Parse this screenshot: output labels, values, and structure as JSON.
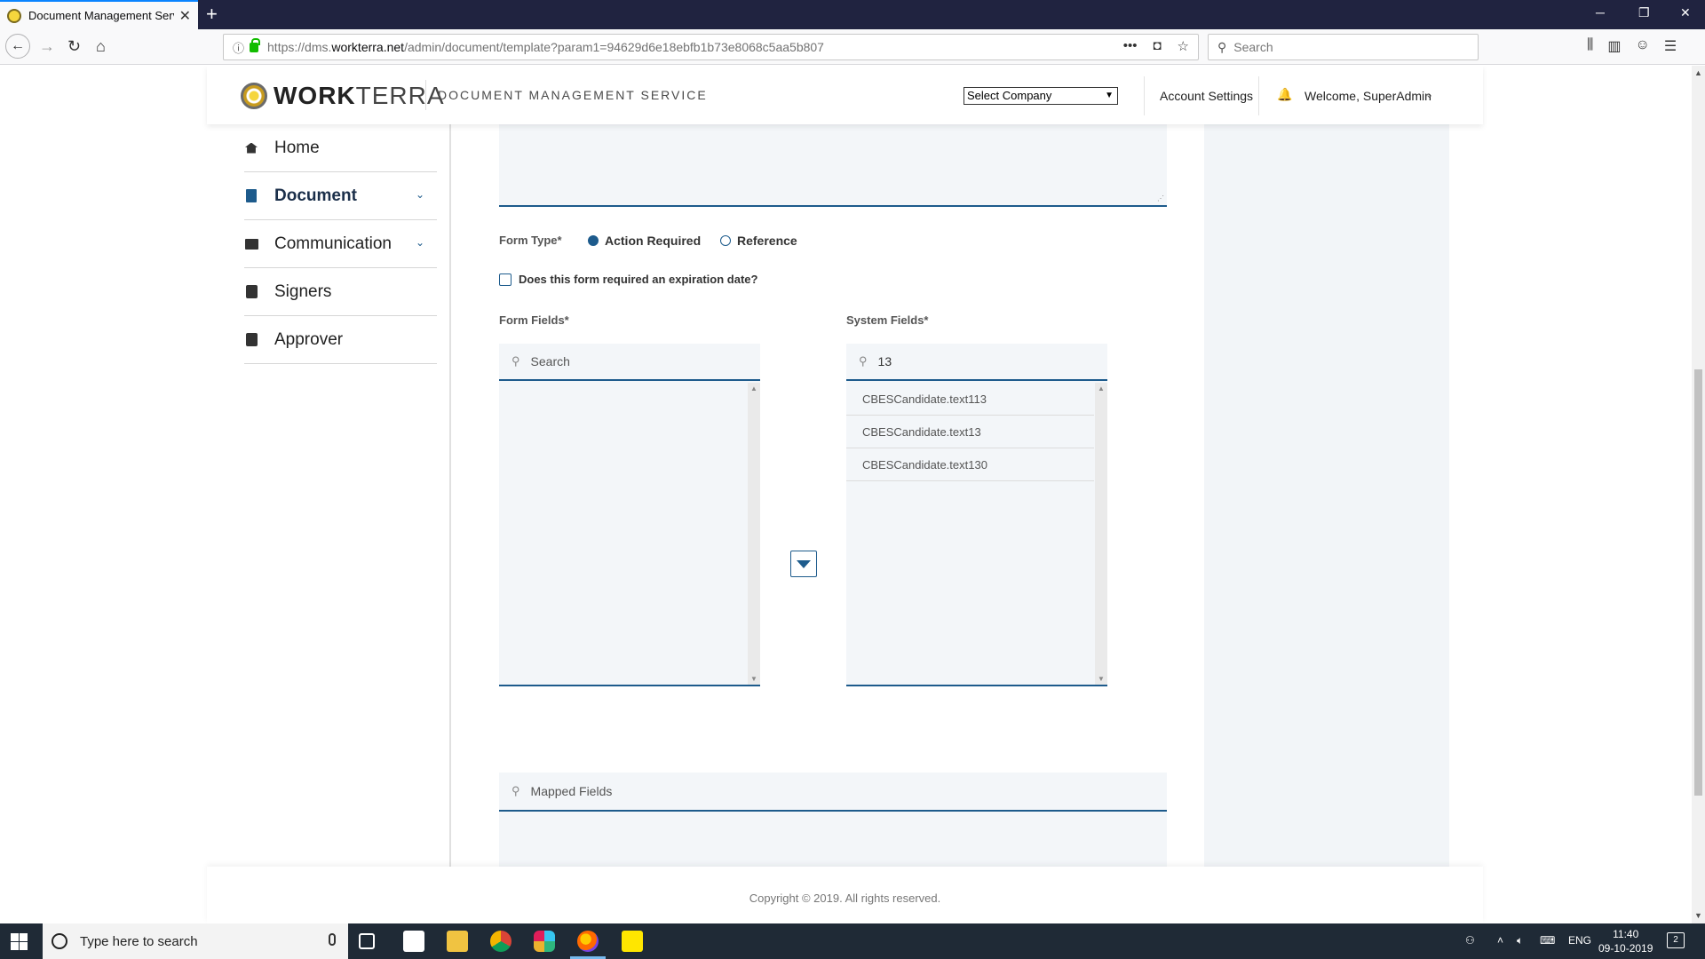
{
  "browser": {
    "tab_title": "Document Management Servic",
    "new_tab_label": "+",
    "url_prefix": "https://dms.",
    "url_domain": "workterra.net",
    "url_path": "/admin/document/template?param1=94629d6e18ebfb1b73e8068c5aa5b807",
    "search_placeholder": "Search"
  },
  "header": {
    "logo_bold": "WORK",
    "logo_thin": "TERRA",
    "service_name": "DOCUMENT MANAGEMENT SERVICE",
    "company_select": "Select Company",
    "account_settings": "Account Settings",
    "welcome": "Welcome, SuperAdmin"
  },
  "sidebar": {
    "items": [
      {
        "label": "Home"
      },
      {
        "label": "Document"
      },
      {
        "label": "Communication"
      },
      {
        "label": "Signers"
      },
      {
        "label": "Approver"
      }
    ]
  },
  "form": {
    "form_type_label": "Form Type*",
    "option_action": "Action Required",
    "option_reference": "Reference",
    "selected_option": "Action Required",
    "expiration_label": "Does this form required an expiration date?",
    "expiration_checked": false,
    "form_fields_label": "Form Fields*",
    "form_fields_search": "Search",
    "system_fields_label": "System Fields*",
    "system_fields_query": "13",
    "system_fields": [
      "CBESCandidate.text113",
      "CBESCandidate.text13",
      "CBESCandidate.text130"
    ],
    "mapped_fields_search": "Mapped Fields"
  },
  "footer": {
    "copyright": "Copyright © 2019. All rights reserved."
  },
  "taskbar": {
    "search_placeholder": "Type here to search",
    "language": "ENG",
    "time": "11:40",
    "date": "09-10-2019",
    "notifications": "2"
  },
  "colors": {
    "accent": "#1d5b8c",
    "panel": "#f3f6f9",
    "browser_frame": "#202340"
  }
}
